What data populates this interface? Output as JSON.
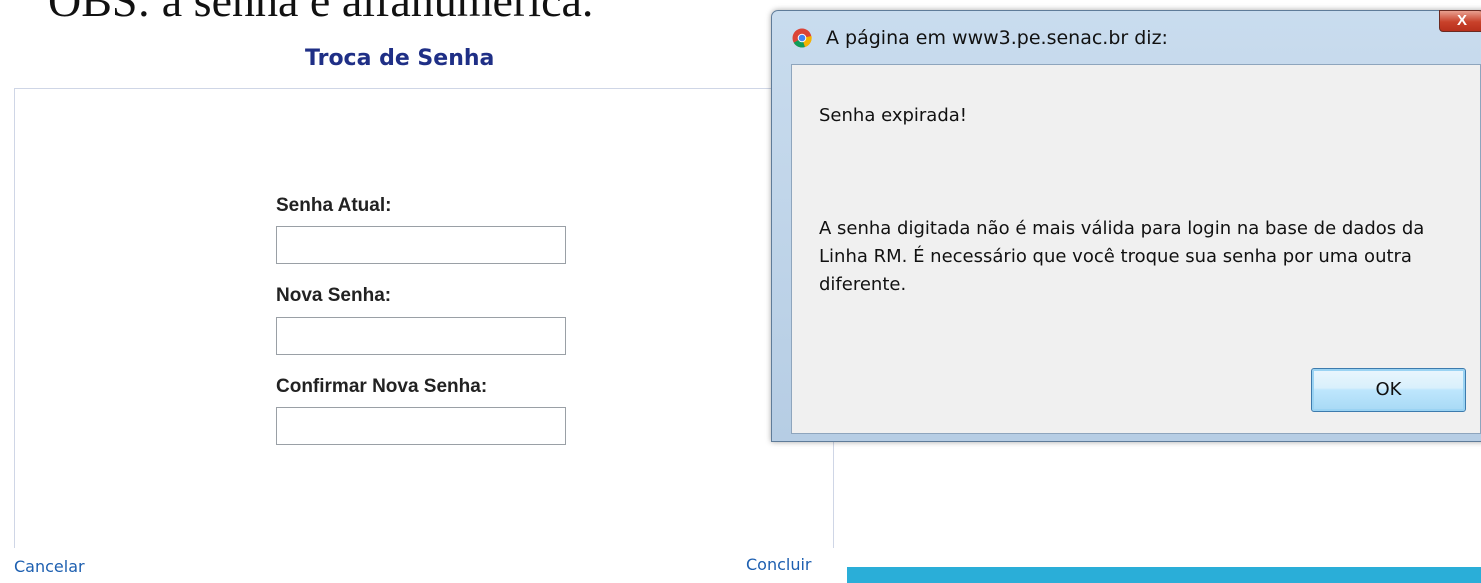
{
  "caption": "OBS: a senha é alfanumérica.",
  "form": {
    "title": "Troca de Senha",
    "fields": [
      {
        "label": "Senha Atual:",
        "value": ""
      },
      {
        "label": "Nova Senha:",
        "value": ""
      },
      {
        "label": "Confirmar Nova Senha:",
        "value": ""
      }
    ],
    "cancel_label": "Cancelar",
    "submit_label": "Concluir"
  },
  "dialog": {
    "title": "A página em www3.pe.senac.br diz:",
    "close_label": "X",
    "heading": "Senha expirada!",
    "message": "A senha digitada não é mais válida para login na base de dados da Linha RM. É necessário que você troque sua senha por uma outra diferente.",
    "ok_label": "OK"
  },
  "icons": {
    "browser": "chrome-icon",
    "close": "close-icon"
  },
  "colors": {
    "title": "#1f2f86",
    "link": "#1d5fb0",
    "bar": "#2aaed8"
  }
}
